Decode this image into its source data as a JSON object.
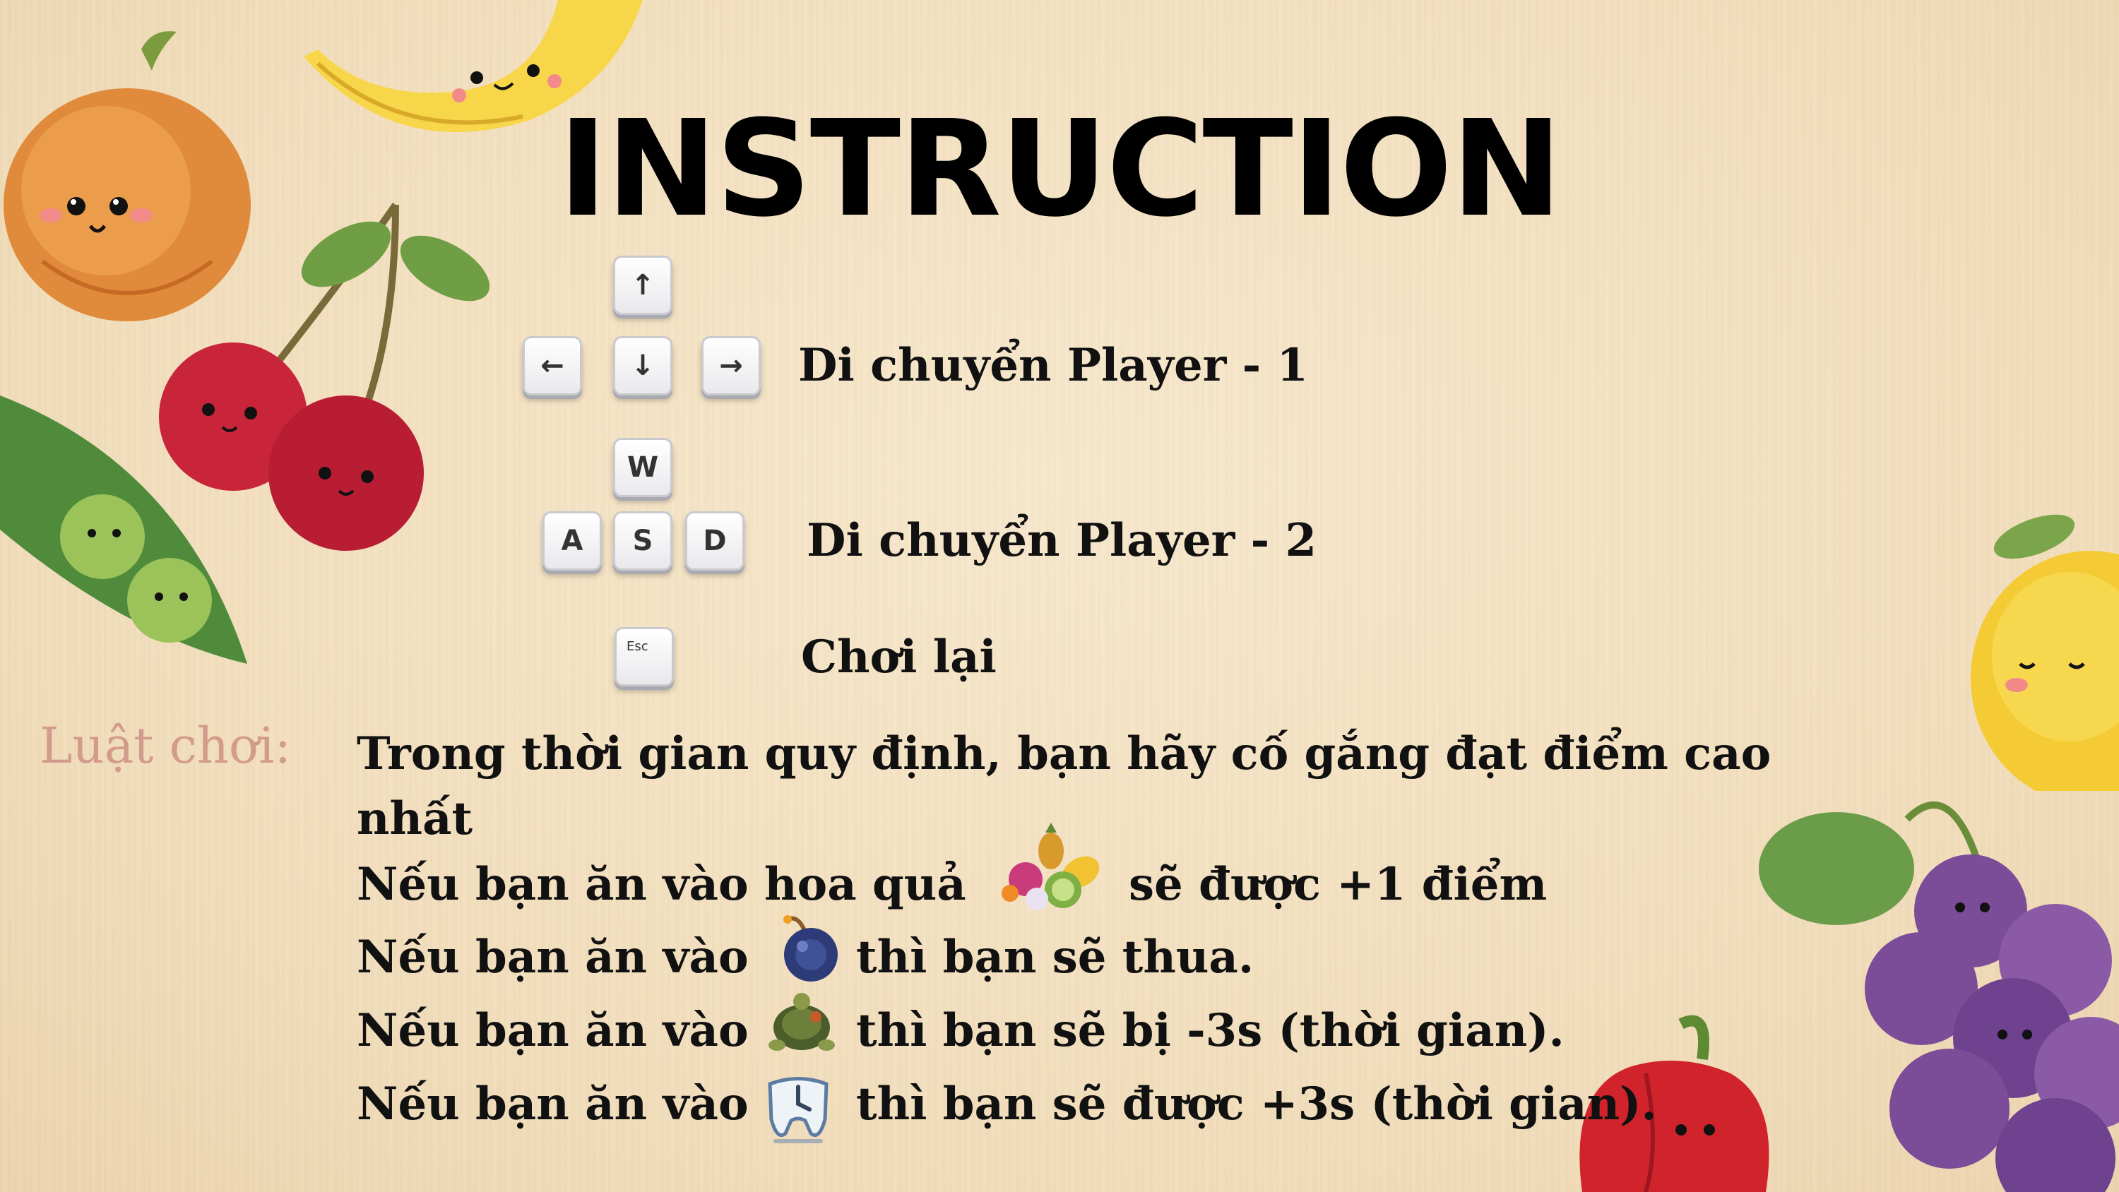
{
  "title": "INSTRUCTION",
  "controls": {
    "player1": {
      "keys": [
        "↑",
        "←",
        "↓",
        "→"
      ],
      "label": "Di chuyển Player - 1"
    },
    "player2": {
      "keys": [
        "W",
        "A",
        "S",
        "D"
      ],
      "label": "Di chuyển Player - 2"
    },
    "restart": {
      "key": "Esc",
      "label": "Chơi lại"
    }
  },
  "rules": {
    "title": "Luật chơi:",
    "line1a": "Trong thời gian quy định, bạn hãy cố gắng đạt điểm cao",
    "line1b": "nhất",
    "fruit_before": "Nếu bạn ăn vào hoa quả",
    "fruit_after": "sẽ được +1 điểm",
    "bomb_before": "Nếu bạn ăn vào",
    "bomb_after": "thì bạn sẽ thua.",
    "turtle_before": "Nếu bạn ăn vào",
    "turtle_after": "thì bạn sẽ bị -3s (thời gian).",
    "clock_before": "Nếu bạn ăn vào",
    "clock_after": "thì bạn sẽ được +3s (thời gian)."
  },
  "icons": {
    "fruit": "fruit-basket-icon",
    "bomb": "bomb-icon",
    "turtle": "turtle-icon",
    "clock": "clock-icon"
  },
  "colors": {
    "background": "#f3e1c2",
    "rules_title": "#d39b8c",
    "text": "#111111"
  }
}
